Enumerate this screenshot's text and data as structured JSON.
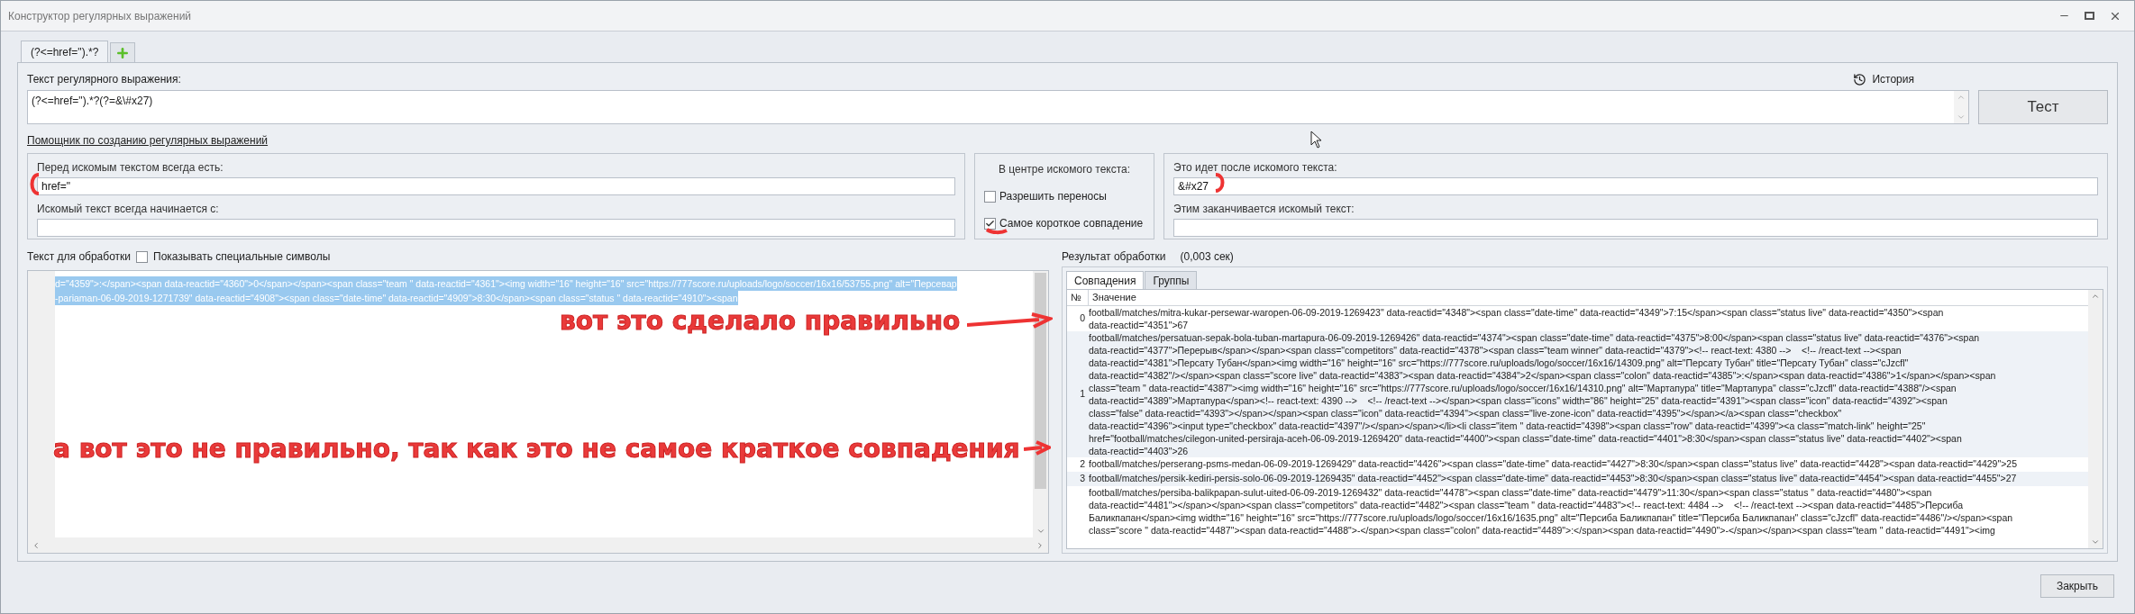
{
  "window": {
    "title": "Конструктор регулярных выражений"
  },
  "tabs": [
    {
      "label": "(?<=href=\").*?",
      "selected": true
    }
  ],
  "regex": {
    "label": "Текст регулярного выражения:",
    "value": "(?<=href=\").*?(?=&\\#x27)",
    "history": "История",
    "test_button": "Тест"
  },
  "helper": {
    "link": "Помощник по созданию регулярных выражений",
    "before": {
      "label": "Перед искомым текстом всегда есть:",
      "value": "href=\""
    },
    "starts": {
      "label": "Искомый текст всегда начинается с:"
    },
    "center": {
      "title": "В центре искомого текста:",
      "options": [
        {
          "label": "Разрешить переносы",
          "checked": false
        },
        {
          "label": "Самое короткое совпадение",
          "checked": true
        }
      ]
    },
    "after": {
      "label": "Это идет после искомого текста:",
      "value": "&#x27"
    },
    "ends": {
      "label": "Этим заканчивается искомый текст:"
    }
  },
  "input": {
    "label": "Текст для обработки",
    "special": {
      "label": "Показывать специальные символы",
      "checked": false
    },
    "lines": [
      "d=\"4359\">:</span><span data-reactid=\"4360\">0</span></span><span class=\"team \" data-reactid=\"4361\"><img width=\"16\" height=\"16\" src=\"https://777score.ru/uploads/logo/soccer/16x16/53755.png\" alt=\"Персевар",
      "-pariaman-06-09-2019-1271739\" data-reactid=\"4908\"><span class=\"date-time\" data-reactid=\"4909\">8:30</span><span class=\"status \" data-reactid=\"4910\"><span"
    ]
  },
  "result": {
    "label": "Результат обработки",
    "time": "(0,003 сек)",
    "tabs": [
      {
        "label": "Совпадения",
        "selected": true
      },
      {
        "label": "Группы",
        "selected": false
      }
    ],
    "columns": [
      "№",
      "Значение"
    ],
    "rows": [
      {
        "index": "0",
        "lines": [
          "football/matches/mitra-kukar-persewar-waropen-06-09-2019-1269423\" data-reactid=\"4348\"><span class=\"date-time\" data-reactid=\"4349\">7:15</span><span class=\"status live\" data-reactid=\"4350\"><span",
          "data-reactid=\"4351\">67"
        ]
      },
      {
        "index": "1",
        "lines": [
          "football/matches/persatuan-sepak-bola-tuban-martapura-06-09-2019-1269426\" data-reactid=\"4374\"><span class=\"date-time\" data-reactid=\"4375\">8:00</span><span class=\"status live\" data-reactid=\"4376\"><span",
          "data-reactid=\"4377\">Перерыв</span></span><span class=\"competitors\" data-reactid=\"4378\"><span class=\"team winner\" data-reactid=\"4379\"><!-- react-text: 4380 -->    <!-- /react-text --><span",
          "data-reactid=\"4381\">Персату Тубан</span><img width=\"16\" height=\"16\" src=\"https://777score.ru/uploads/logo/soccer/16x16/14309.png\" alt=\"Персату Тубан\" title=\"Персату Тубан\" class=\"cJzcfl\"",
          "data-reactid=\"4382\"/></span><span class=\"score live\" data-reactid=\"4383\"><span data-reactid=\"4384\">2</span><span class=\"colon\" data-reactid=\"4385\">:</span><span data-reactid=\"4386\">1</span></span><span",
          "class=\"team \" data-reactid=\"4387\"><img width=\"16\" height=\"16\" src=\"https://777score.ru/uploads/logo/soccer/16x16/14310.png\" alt=\"Мартапура\" title=\"Мартапура\" class=\"cJzcfl\" data-reactid=\"4388\"/><span",
          "data-reactid=\"4389\">Мартапура</span><!-- react-text: 4390 -->    <!-- /react-text --></span><span class=\"icons\" width=\"86\" height=\"25\" data-reactid=\"4391\"><span class=\"icon\" data-reactid=\"4392\"><span",
          "class=\"false\" data-reactid=\"4393\"></span></span><span class=\"icon\" data-reactid=\"4394\"><span class=\"live-zone-icon\" data-reactid=\"4395\"></span></a><span class=\"checkbox\"",
          "data-reactid=\"4396\"><input type=\"checkbox\" data-reactid=\"4397\"/></span></span></li><li class=\"item \" data-reactid=\"4398\"><span class=\"row\" data-reactid=\"4399\"><a class=\"match-link\" height=\"25\"",
          "href=\"football/matches/cilegon-united-persiraja-aceh-06-09-2019-1269420\" data-reactid=\"4400\"><span class=\"date-time\" data-reactid=\"4401\">8:30</span><span class=\"status live\" data-reactid=\"4402\"><span",
          "data-reactid=\"4403\">26"
        ]
      },
      {
        "index": "2",
        "lines": [
          "football/matches/perserang-psms-medan-06-09-2019-1269429\" data-reactid=\"4426\"><span class=\"date-time\" data-reactid=\"4427\">8:30</span><span class=\"status live\" data-reactid=\"4428\"><span data-reactid=\"4429\">25"
        ]
      },
      {
        "index": "3",
        "lines": [
          "football/matches/persik-kediri-persis-solo-06-09-2019-1269435\" data-reactid=\"4452\"><span class=\"date-time\" data-reactid=\"4453\">8:30</span><span class=\"status live\" data-reactid=\"4454\"><span data-reactid=\"4455\">27"
        ]
      },
      {
        "lines": [
          "football/matches/persiba-balikpapan-sulut-uited-06-09-2019-1269432\" data-reactid=\"4478\"><span class=\"date-time\" data-reactid=\"4479\">11:30</span><span class=\"status \" data-reactid=\"4480\"><span",
          "data-reactid=\"4481\"></span></span><span class=\"competitors\" data-reactid=\"4482\"><span class=\"team \" data-reactid=\"4483\"><!-- react-text: 4484 -->    <!-- /react-text --><span data-reactid=\"4485\">Персиба",
          "Баликпапан</span><img width=\"16\" height=\"16\" src=\"https://777score.ru/uploads/logo/soccer/16x16/1635.png\" alt=\"Персиба Баликпапан\" title=\"Персиба Баликпапан\" class=\"cJzcfl\" data-reactid=\"4486\"/></span><span",
          "class=\"score \" data-reactid=\"4487\"><span data-reactid=\"4488\">-</span><span class=\"colon\" data-reactid=\"4489\">:</span><span data-reactid=\"4490\">-</span></span><span class=\"team \" data-reactid=\"4491\"><img"
        ]
      }
    ]
  },
  "close_button": "Закрыть",
  "annotations": [
    {
      "text": "вот это сделало правильно"
    },
    {
      "text": "а вот это не правильно, так как это не самое краткое совпадения"
    }
  ]
}
